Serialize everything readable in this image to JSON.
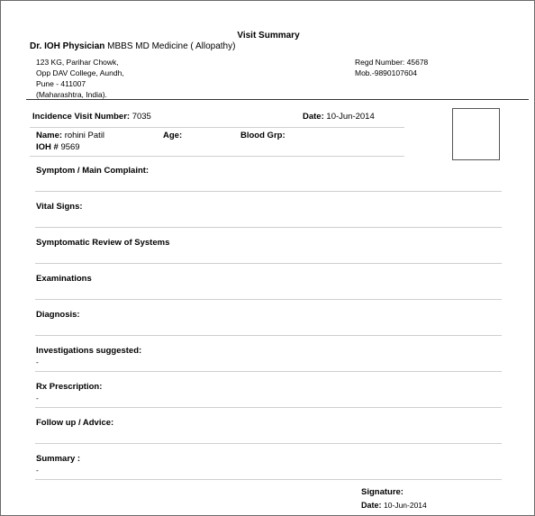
{
  "document": {
    "title": "Visit Summary",
    "doctor": {
      "name": "Dr. IOH Physician",
      "qualification": "MBBS MD Medicine ( Allopathy)"
    },
    "address_lines": [
      "123 KG, Parihar Chowk,",
      "Opp DAV College, Aundh,",
      "Pune - 411007",
      "(Maharashtra, India)."
    ],
    "regd": "Regd Number: 45678",
    "mobile": "Mob.-9890107604"
  },
  "visit": {
    "incidence_label": "Incidence Visit Number:",
    "incidence_value": "7035",
    "date_label": "Date:",
    "date_value": "10-Jun-2014",
    "name_label": "Name:",
    "name_value": "rohini Patil",
    "age_label": "Age:",
    "age_value": "",
    "blood_label": "Blood Grp:",
    "blood_value": "",
    "ioh_label": "IOH #",
    "ioh_value": "9569"
  },
  "sections": [
    {
      "label": "Symptom / Main Complaint:",
      "value": ""
    },
    {
      "label": "Vital Signs:",
      "value": ""
    },
    {
      "label": "Symptomatic Review of Systems",
      "value": ""
    },
    {
      "label": "Examinations",
      "value": ""
    },
    {
      "label": "Diagnosis:",
      "value": ""
    },
    {
      "label": "Investigations suggested:",
      "value": "-"
    },
    {
      "label": "Rx Prescription:",
      "value": "-"
    },
    {
      "label": "Follow up / Advice:",
      "value": ""
    },
    {
      "label": "Summary :",
      "value": "-"
    }
  ],
  "signature": {
    "label": "Signature:",
    "date_label": "Date:",
    "date_value": "10-Jun-2014"
  }
}
